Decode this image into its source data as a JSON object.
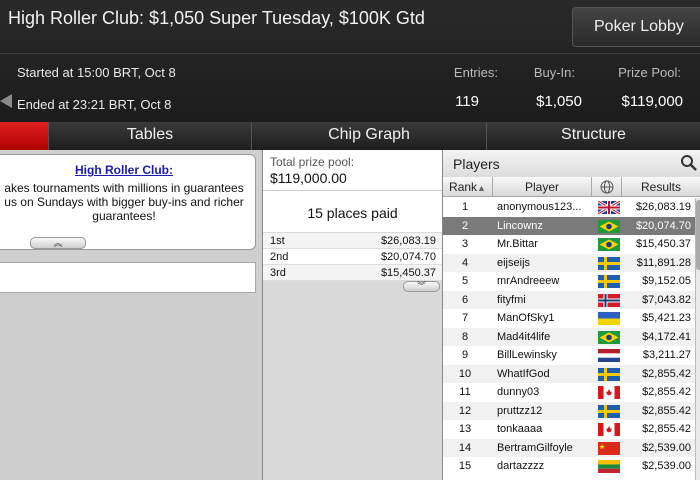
{
  "header": {
    "title": "High Roller Club: $1,050 Super Tuesday, $100K Gtd",
    "lobby_button": "Poker Lobby",
    "started": "Started at 15:00 BRT, Oct 8",
    "ended": "Ended at 23:21 BRT, Oct 8",
    "stats": [
      {
        "label": "Entries:",
        "value": "119"
      },
      {
        "label": "Buy-In:",
        "value": "$1,050"
      },
      {
        "label": "Prize Pool:",
        "value": "$119,000"
      }
    ]
  },
  "tabs": [
    "",
    "Tables",
    "Chip Graph",
    "Structure"
  ],
  "promo": {
    "link": "High Roller Club:",
    "line1": "akes tournaments with millions in guarantees",
    "line2": "us on Sundays with bigger buy-ins and richer",
    "line3": "guarantees!",
    "toggle_icon": "chevron-up-icon"
  },
  "prize": {
    "label": "Total prize pool:",
    "amount": "$119,000.00",
    "places": "15 places paid",
    "payouts": [
      {
        "place": "1st",
        "amount": "$26,083.19"
      },
      {
        "place": "2nd",
        "amount": "$20,074.70"
      },
      {
        "place": "3rd",
        "amount": "$15,450.37"
      }
    ]
  },
  "players": {
    "title": "Players",
    "columns": [
      "Rank",
      "Player",
      "Results"
    ],
    "sort_indicator": "▲",
    "selected_rank": 2,
    "rows": [
      {
        "rank": "1",
        "name": "anonymous123...",
        "flag": "uk",
        "result": "$26,083.19"
      },
      {
        "rank": "2",
        "name": "Lincownz",
        "flag": "br",
        "result": "$20,074.70"
      },
      {
        "rank": "3",
        "name": "Mr.Bittar",
        "flag": "br",
        "result": "$15,450.37"
      },
      {
        "rank": "4",
        "name": "eijseijs",
        "flag": "se",
        "result": "$11,891.28"
      },
      {
        "rank": "5",
        "name": "mrAndreeew",
        "flag": "se",
        "result": "$9,152.05"
      },
      {
        "rank": "6",
        "name": "fityfmi",
        "flag": "no",
        "result": "$7,043.82"
      },
      {
        "rank": "7",
        "name": "ManOfSky1",
        "flag": "ua",
        "result": "$5,421.23"
      },
      {
        "rank": "8",
        "name": "Mad4it4life",
        "flag": "br",
        "result": "$4,172.41"
      },
      {
        "rank": "9",
        "name": "BillLewinsky",
        "flag": "nl",
        "result": "$3,211.27"
      },
      {
        "rank": "10",
        "name": "WhatIfGod",
        "flag": "se",
        "result": "$2,855.42"
      },
      {
        "rank": "11",
        "name": "dunny03",
        "flag": "ca",
        "result": "$2,855.42"
      },
      {
        "rank": "12",
        "name": "pruttzz12",
        "flag": "se",
        "result": "$2,855.42"
      },
      {
        "rank": "13",
        "name": "tonkaaaa",
        "flag": "ca",
        "result": "$2,855.42"
      },
      {
        "rank": "14",
        "name": "BertramGilfoyle",
        "flag": "cn",
        "result": "$2,539.00"
      },
      {
        "rank": "15",
        "name": "dartazzzz",
        "flag": "lt",
        "result": "$2,539.00"
      }
    ]
  }
}
